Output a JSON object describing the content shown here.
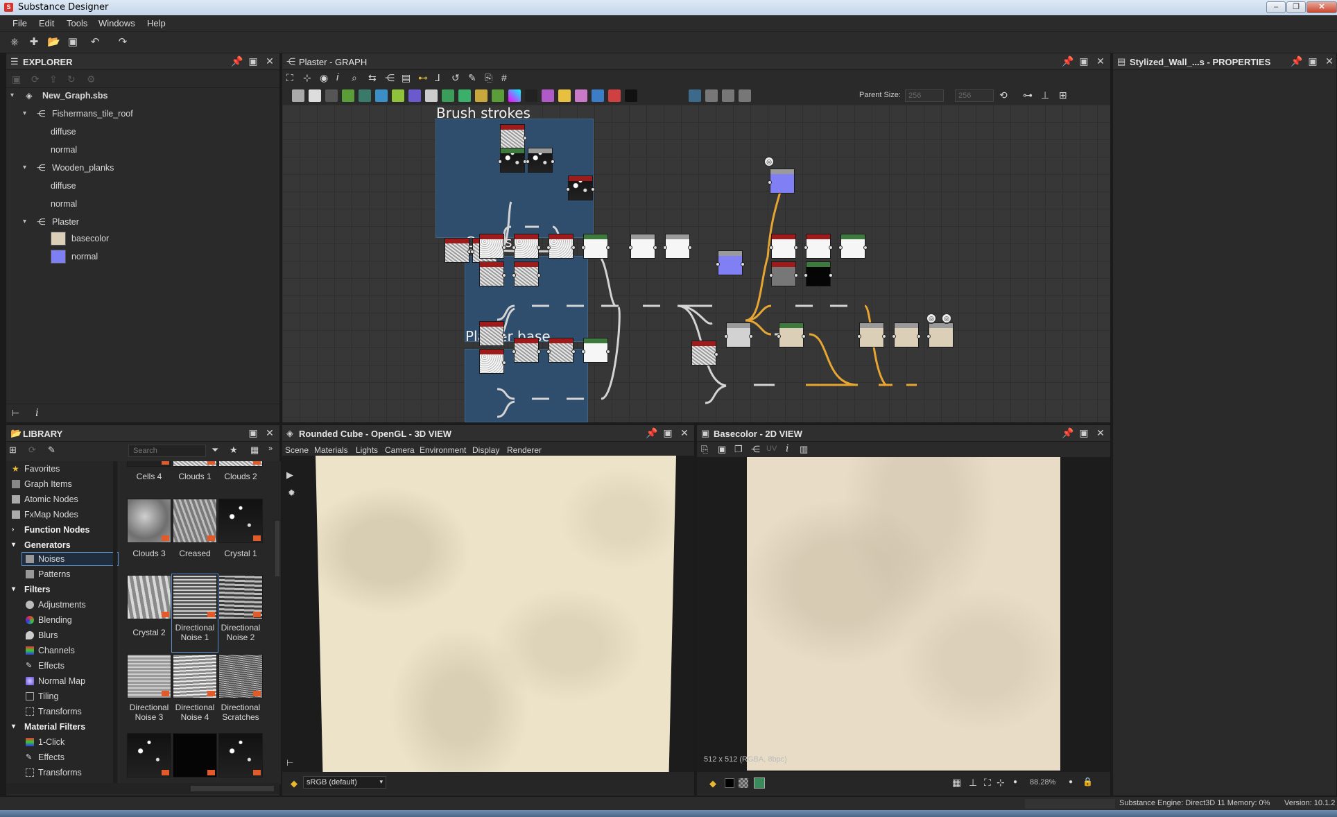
{
  "app": {
    "title": "Substance Designer"
  },
  "menu": [
    "File",
    "Edit",
    "Tools",
    "Windows",
    "Help"
  ],
  "explorer": {
    "title": "EXPLORER",
    "items": [
      {
        "label": "New_Graph.sbs"
      },
      {
        "label": "Fishermans_tile_roof"
      },
      {
        "label": "diffuse"
      },
      {
        "label": "normal"
      },
      {
        "label": "Wooden_planks"
      },
      {
        "label": "diffuse"
      },
      {
        "label": "normal"
      },
      {
        "label": "Plaster"
      },
      {
        "label": "basecolor"
      },
      {
        "label": "normal"
      }
    ],
    "swatch_colors": {
      "basecolor": "#dccfb8",
      "normal": "#7f7ff5"
    }
  },
  "graph": {
    "title": "Plaster - GRAPH",
    "parent_size_label": "Parent Size:",
    "parent_size_value": "256",
    "parent_size_value2": "256",
    "frames": [
      {
        "title": "Brush strokes"
      },
      {
        "title": "Cracks"
      },
      {
        "title": "Plaster base"
      }
    ]
  },
  "properties": {
    "title": "Stylized_Wall_...s - PROPERTIES"
  },
  "library": {
    "title": "LIBRARY",
    "search_placeholder": "Search",
    "categories": [
      "Favorites",
      "Graph Items",
      "Atomic Nodes",
      "FxMap Nodes",
      "Function Nodes",
      "Generators",
      "Noises",
      "Patterns",
      "Filters",
      "Adjustments",
      "Blending",
      "Blurs",
      "Channels",
      "Effects",
      "Normal Map",
      "Tiling",
      "Transforms",
      "Material Filters",
      "1-Click",
      "Effects",
      "Transforms"
    ],
    "thumbs": [
      {
        "label": "Cells 4"
      },
      {
        "label": "Clouds 1"
      },
      {
        "label": "Clouds 2"
      },
      {
        "label": "Clouds 3"
      },
      {
        "label": "Creased"
      },
      {
        "label": "Crystal 1"
      },
      {
        "label": "Crystal 2"
      },
      {
        "label": "Directional Noise 1"
      },
      {
        "label": "Directional Noise 2"
      },
      {
        "label": "Directional Noise 3"
      },
      {
        "label": "Directional Noise 4"
      },
      {
        "label": "Directional Scratches"
      }
    ]
  },
  "view3d": {
    "title": "Rounded Cube - OpenGL - 3D VIEW",
    "menu": [
      "Scene",
      "Materials",
      "Lights",
      "Camera",
      "Environment",
      "Display",
      "Renderer"
    ],
    "colorspace": "sRGB (default)"
  },
  "view2d": {
    "title": "Basecolor - 2D VIEW",
    "uv_label": "UV",
    "resolution": "512 x 512 (RGBA, 8bpc)",
    "zoom": "88.28%"
  },
  "status": {
    "engine": "Substance Engine: Direct3D 11  Memory: 0%",
    "version": "Version: 10.1.2"
  }
}
